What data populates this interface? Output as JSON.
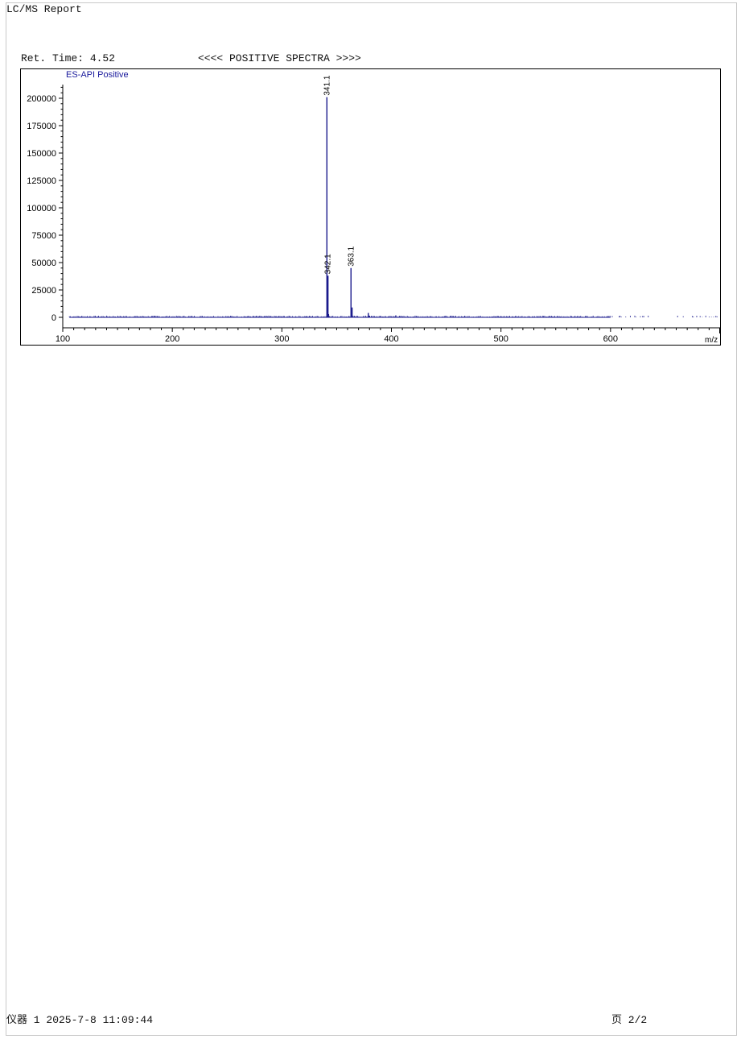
{
  "report": {
    "title": "LC/MS Report",
    "ret_time": "Ret. Time: 4.52",
    "spectra_header": "<<<< POSITIVE SPECTRA >>>>"
  },
  "footer": {
    "left": "仪器 1 2025-7-8 11:09:44",
    "right": "页 2/2"
  },
  "colors": {
    "trace": "#1a1a8c",
    "series_label": "#1a1a9c",
    "axis": "#000000"
  },
  "chart_data": {
    "type": "line",
    "series_name": "ES-API Positive",
    "xlabel": "m/z",
    "ylabel": "",
    "xlim": [
      100,
      700
    ],
    "ylim": [
      0,
      210000
    ],
    "x_ticks": [
      100,
      200,
      300,
      400,
      500,
      600
    ],
    "y_ticks": [
      0,
      25000,
      50000,
      75000,
      100000,
      125000,
      150000,
      175000,
      200000
    ],
    "peaks": [
      {
        "mz": 341.1,
        "intensity": 201000,
        "label": "341.1"
      },
      {
        "mz": 342.1,
        "intensity": 38000,
        "label": "342.1"
      },
      {
        "mz": 363.1,
        "intensity": 45000,
        "label": "363.1"
      },
      {
        "mz": 364.1,
        "intensity": 9000,
        "label": ""
      },
      {
        "mz": 342.6,
        "intensity": 3000,
        "label": ""
      },
      {
        "mz": 378.9,
        "intensity": 4000,
        "label": ""
      },
      {
        "mz": 380.0,
        "intensity": 1500,
        "label": ""
      },
      {
        "mz": 404.0,
        "intensity": 1800,
        "label": ""
      },
      {
        "mz": 322.0,
        "intensity": 900,
        "label": ""
      }
    ],
    "baseline_range": [
      106,
      700
    ],
    "grid": false
  }
}
